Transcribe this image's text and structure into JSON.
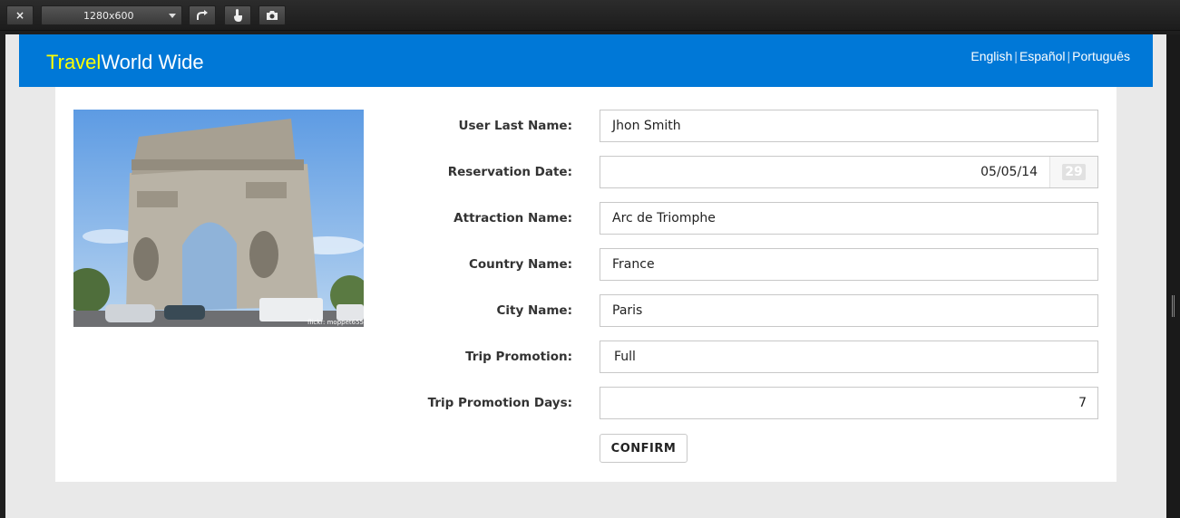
{
  "toolbar": {
    "close_label": "×",
    "resolution": "1280x600",
    "rotate_icon": "rotate-icon",
    "touch_icon": "touch-icon",
    "screenshot_icon": "camera-icon"
  },
  "header": {
    "brand_accent": "Travel",
    "brand_rest": "World Wide",
    "languages": [
      "English",
      "Español",
      "Português"
    ],
    "colors": {
      "bar": "#0078d7",
      "accent": "#ffff00"
    }
  },
  "photo": {
    "credit": "flickr: moppet65535"
  },
  "form": {
    "last_name_label": "User Last Name:",
    "last_name_value": "Jhon Smith",
    "date_label": "Reservation Date:",
    "date_value": "05/05/14",
    "calendar_badge": "29",
    "attraction_label": "Attraction Name:",
    "attraction_value": "Arc de Triomphe",
    "country_label": "Country Name:",
    "country_value": "France",
    "city_label": "City Name:",
    "city_value": "Paris",
    "promotion_label": "Trip Promotion:",
    "promotion_value": "Full",
    "days_label": "Trip Promotion Days:",
    "days_value": "7",
    "confirm_label": "CONFIRM"
  }
}
